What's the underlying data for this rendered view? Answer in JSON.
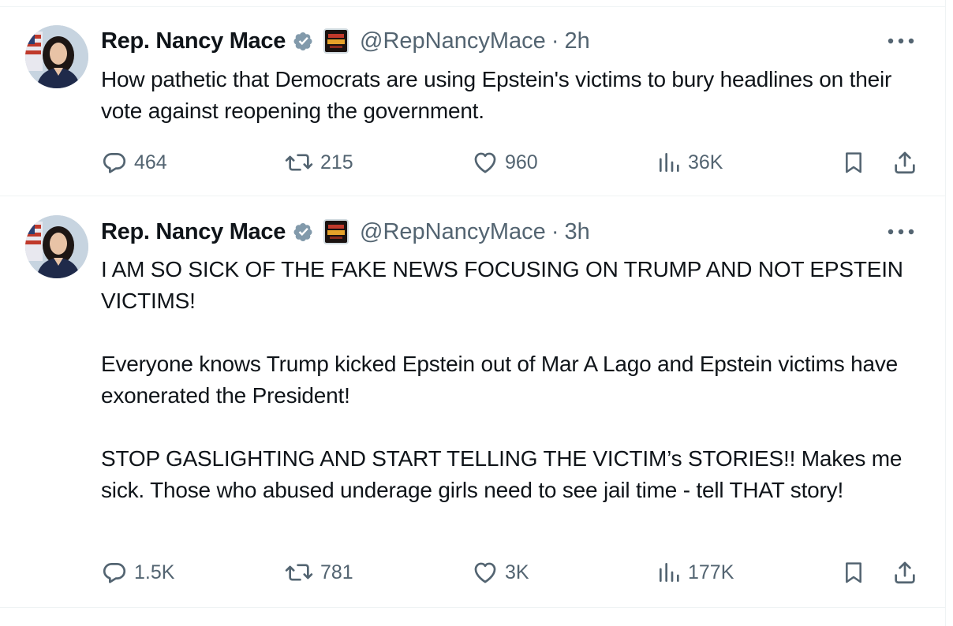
{
  "tweets": [
    {
      "author_name": "Rep. Nancy Mace",
      "handle": "@RepNancyMace",
      "separator": "·",
      "time": "2h",
      "text": "How pathetic that Democrats are using Epstein's victims to bury headlines on their vote against reopening the government.",
      "replies": "464",
      "reposts": "215",
      "likes": "960",
      "views": "36K"
    },
    {
      "author_name": "Rep. Nancy Mace",
      "handle": "@RepNancyMace",
      "separator": "·",
      "time": "3h",
      "text": "I AM SO SICK OF THE FAKE NEWS FOCUSING ON TRUMP AND NOT EPSTEIN VICTIMS!\n\nEveryone knows Trump kicked Epstein out of Mar A Lago and Epstein victims have exonerated the President!\n\nSTOP GASLIGHTING AND START TELLING THE VICTIM’s STORIES!! Makes me sick. Those who abused underage girls need to see jail time - tell THAT story!",
      "replies": "1.5K",
      "reposts": "781",
      "likes": "3K",
      "views": "177K"
    }
  ],
  "icons": {
    "verified": "verified-badge-icon",
    "affiliate": "affiliate-badge-icon",
    "more": "more-options-icon",
    "reply": "reply-icon",
    "repost": "repost-icon",
    "like": "like-icon",
    "views": "views-icon",
    "bookmark": "bookmark-icon",
    "share": "share-icon"
  },
  "colors": {
    "text": "#0f1419",
    "secondary": "#536471",
    "verified_badge": "#829aab",
    "divider": "#eff3f4"
  }
}
